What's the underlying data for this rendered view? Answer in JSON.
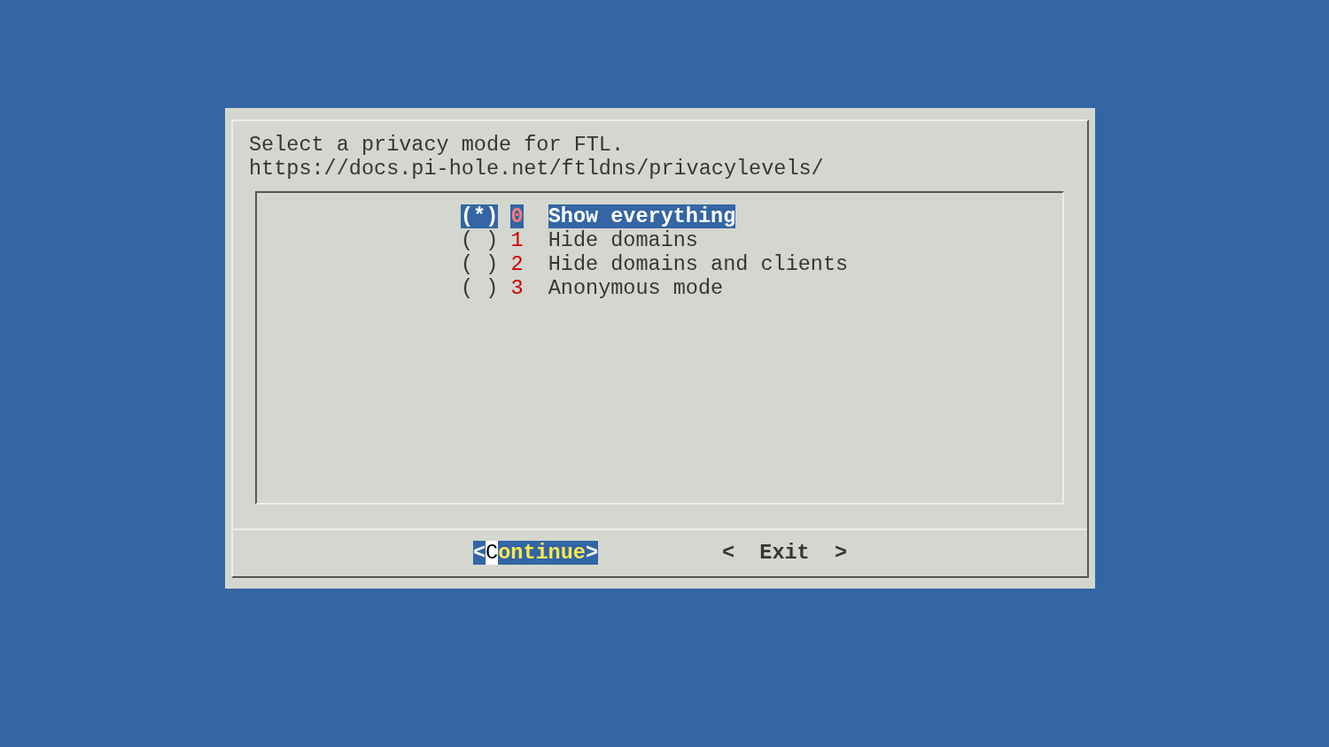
{
  "dialog": {
    "prompt": "Select a privacy mode for FTL.",
    "url": "https://docs.pi-hole.net/ftldns/privacylevels/",
    "options": [
      {
        "marker": "(*)",
        "tag": "0",
        "label": "Show everything",
        "selected": true
      },
      {
        "marker": "( )",
        "tag": "1",
        "label": "Hide domains",
        "selected": false
      },
      {
        "marker": "( )",
        "tag": "2",
        "label": "Hide domains and clients",
        "selected": false
      },
      {
        "marker": "( )",
        "tag": "3",
        "label": "Anonymous mode",
        "selected": false
      }
    ],
    "buttons": [
      {
        "open": "<",
        "label": "Continue",
        "close": ">",
        "selected": true
      },
      {
        "open": "<",
        "label": "Exit",
        "close": ">",
        "selected": false
      }
    ]
  }
}
